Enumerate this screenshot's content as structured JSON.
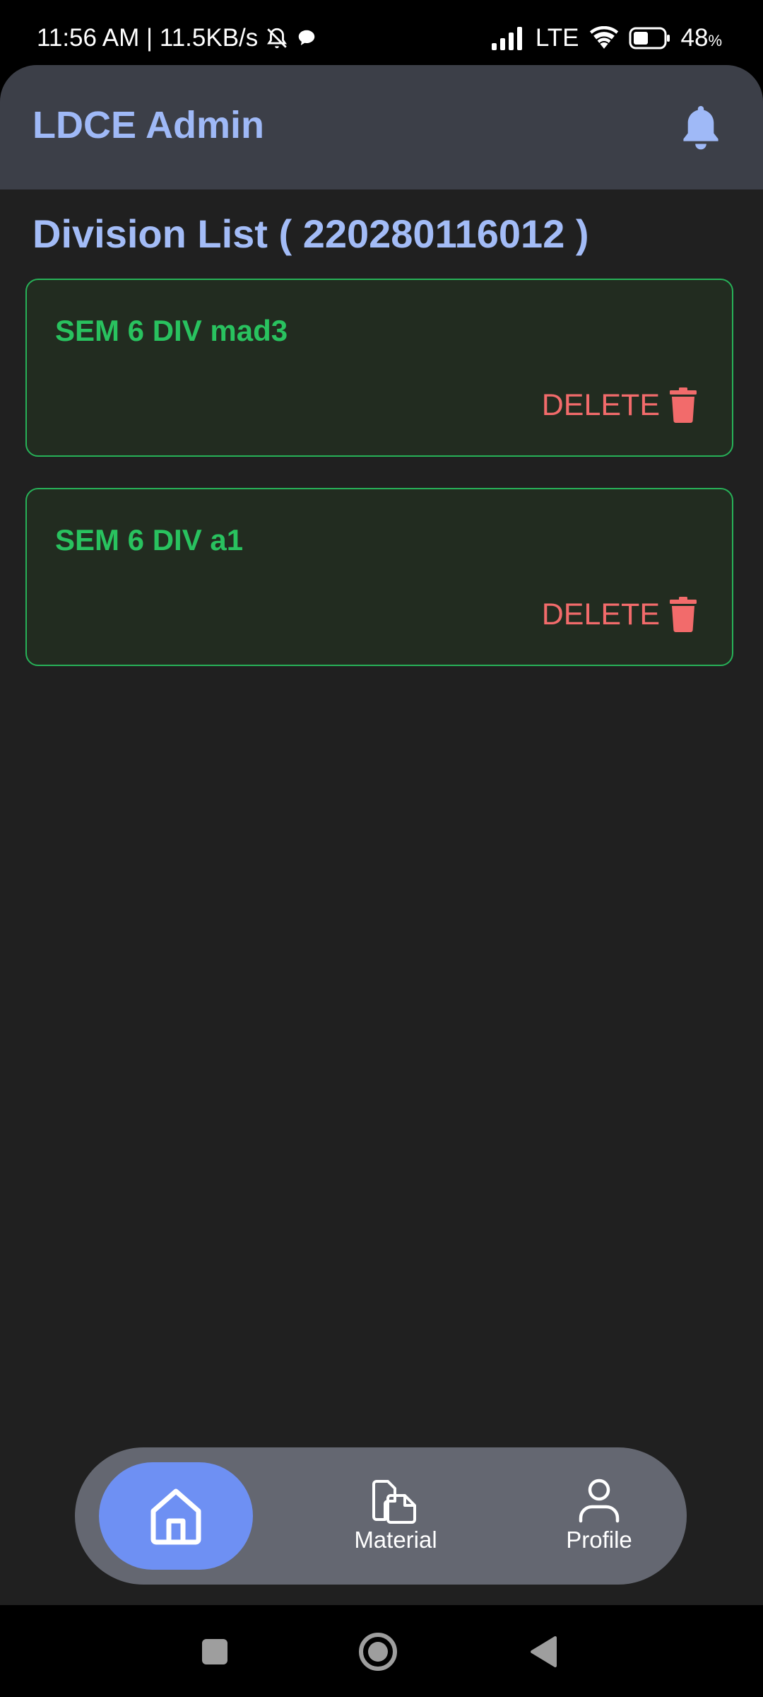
{
  "status_bar": {
    "time": "11:56 AM | 11.5KB/s",
    "network": "LTE",
    "battery": "48",
    "battery_unit": "%"
  },
  "app_bar": {
    "title": "LDCE Admin"
  },
  "page": {
    "title": "Division List ( 220280116012 )"
  },
  "divisions": [
    {
      "name": "SEM 6 DIV mad3",
      "delete_label": "DELETE"
    },
    {
      "name": "SEM 6 DIV a1",
      "delete_label": "DELETE"
    }
  ],
  "bottom_nav": {
    "items": [
      {
        "label": "",
        "icon": "home-icon"
      },
      {
        "label": "Material",
        "icon": "documents-icon"
      },
      {
        "label": "Profile",
        "icon": "person-icon"
      }
    ]
  },
  "colors": {
    "accent": "#9fb9f7",
    "card_border": "#27b158",
    "card_text": "#29c25f",
    "delete": "#f26b6b",
    "nav_active": "#6e90f3"
  }
}
